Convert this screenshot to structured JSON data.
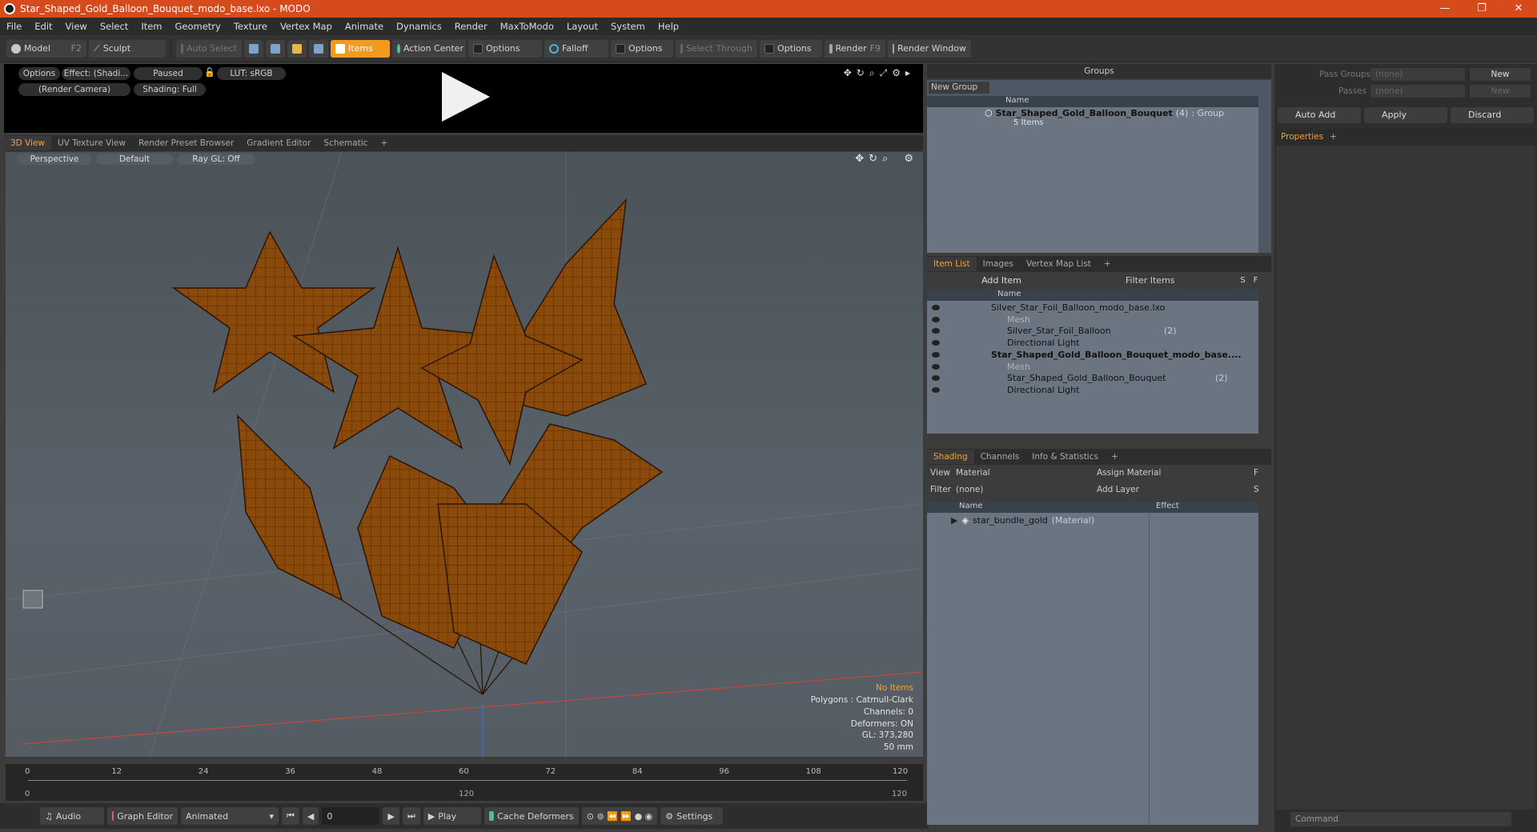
{
  "window": {
    "title": "Star_Shaped_Gold_Balloon_Bouquet_modo_base.lxo - MODO",
    "minimize": "—",
    "restore": "❐",
    "close": "✕"
  },
  "menu": [
    "File",
    "Edit",
    "View",
    "Select",
    "Item",
    "Geometry",
    "Texture",
    "Vertex Map",
    "Animate",
    "Dynamics",
    "Render",
    "MaxToModo",
    "Layout",
    "System",
    "Help"
  ],
  "toolbar": {
    "model": "Model",
    "model_key": "F2",
    "sculpt": "Sculpt",
    "auto_select": "Auto Select",
    "items": "Items",
    "action_center": "Action Center",
    "options1": "Options",
    "falloff": "Falloff",
    "options2": "Options",
    "select_through": "Select Through",
    "options3": "Options",
    "render": "Render",
    "render_key": "F9",
    "render_window": "Render Window"
  },
  "preview": {
    "options": "Options",
    "effect": "Effect: (Shadi...",
    "paused": "Paused",
    "lut": "LUT: sRGB",
    "camera": "(Render Camera)",
    "shading": "Shading: Full"
  },
  "viewport_tabs": [
    "3D View",
    "UV Texture View",
    "Render Preset Browser",
    "Gradient Editor",
    "Schematic",
    "+"
  ],
  "viewport": {
    "perspective": "Perspective",
    "default": "Default",
    "raygl": "Ray GL: Off"
  },
  "stats": {
    "no_items": "No Items",
    "polygons": "Polygons : Catmull-Clark",
    "channels": "Channels: 0",
    "deformers": "Deformers: ON",
    "gl": "GL: 373,280",
    "lens": "50 mm"
  },
  "timeline": {
    "ticks": [
      "0",
      "12",
      "24",
      "36",
      "48",
      "60",
      "72",
      "84",
      "96",
      "108",
      "120"
    ],
    "start": "0",
    "mid": "120",
    "end": "120"
  },
  "bottom": {
    "audio": "Audio",
    "graph_editor": "Graph Editor",
    "animated": "Animated",
    "frame": "0",
    "play": "Play",
    "cache": "Cache Deformers",
    "settings": "Settings"
  },
  "groups": {
    "title": "Groups",
    "new_group": "New Group",
    "col_name": "Name",
    "item_name": "Star_Shaped_Gold_Balloon_Bouquet",
    "item_count": "(4)",
    "item_type": ": Group",
    "item_sub": "5 Items"
  },
  "itemlist": {
    "tabs": [
      "Item List",
      "Images",
      "Vertex Map List",
      "+"
    ],
    "add_item": "Add Item",
    "filter": "Filter Items",
    "s": "S",
    "f": "F",
    "col_name": "Name",
    "rows": [
      {
        "label": "Silver_Star_Foil_Balloon_modo_base.lxo",
        "extra": ""
      },
      {
        "label": "Mesh",
        "extra": ""
      },
      {
        "label": "Silver_Star_Foil_Balloon",
        "extra": "(2)"
      },
      {
        "label": "Directional Light",
        "extra": ""
      },
      {
        "label": "Star_Shaped_Gold_Balloon_Bouquet_modo_base....",
        "extra": ""
      },
      {
        "label": "Mesh",
        "extra": ""
      },
      {
        "label": "Star_Shaped_Gold_Balloon_Bouquet",
        "extra": "(2)"
      },
      {
        "label": "Directional Light",
        "extra": ""
      }
    ]
  },
  "shading": {
    "tabs": [
      "Shading",
      "Channels",
      "Info & Statistics",
      "+"
    ],
    "view_label": "View",
    "view_value": "Material",
    "assign": "Assign Material",
    "f": "F",
    "filter_label": "Filter",
    "filter_value": "(none)",
    "add_layer": "Add Layer",
    "s": "S",
    "col_name": "Name",
    "col_effect": "Effect",
    "row_name": "star_bundle_gold",
    "row_type": "(Material)"
  },
  "passes": {
    "pass_groups": "Pass Groups",
    "pass_groups_val": "(none)",
    "new1": "New",
    "passes": "Passes",
    "passes_val": "(none)",
    "new2": "New",
    "auto_add": "Auto Add",
    "apply": "Apply",
    "discard": "Discard",
    "properties": "Properties",
    "plus": "+",
    "command": "Command"
  },
  "colors": {
    "accent": "#f29a1d",
    "title": "#d64a1c",
    "mesh": "#8a4a0c"
  }
}
